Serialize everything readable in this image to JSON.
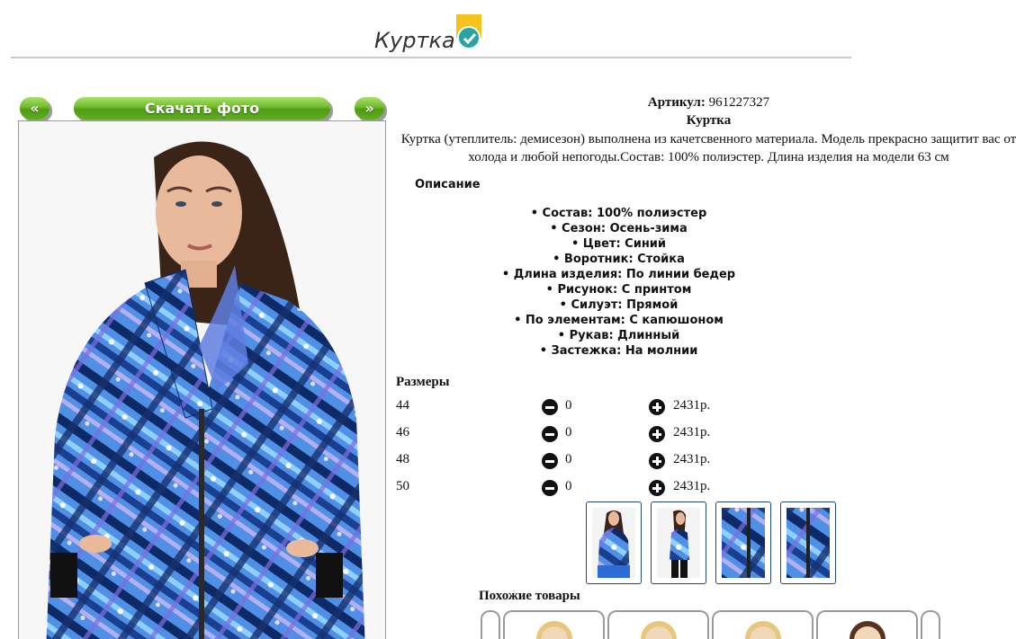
{
  "header": {
    "title": "Куртка"
  },
  "gallery": {
    "prev_label": "«",
    "download_label": "Скачать фото",
    "next_label": "»"
  },
  "product": {
    "article_label": "Артикул:",
    "article_value": "961227327",
    "name": "Куртка",
    "description": "Куртка (утеплитель: демисезон) выполнена из качетсвенного материала. Модель прекрасно защитит вас от холода и любой непогоды.Состав: 100% полиэстер. Длина изделия на модели 63 см",
    "description_title": "Описание",
    "attributes": [
      "• Состав: 100% полиэстер",
      "• Сезон: Осень-зима",
      "• Цвет: Синий",
      "• Воротник: Стойка",
      "• Длина изделия: По линии бедер",
      "• Рисунок: С принтом",
      "• Силуэт: Прямой",
      "• По элементам: С капюшоном",
      "• Рукав: Длинный",
      "• Застежка: На молнии"
    ]
  },
  "sizes": {
    "title": "Размеры",
    "rows": [
      {
        "size": "44",
        "qty": "0",
        "price": "2431р."
      },
      {
        "size": "46",
        "qty": "0",
        "price": "2431р."
      },
      {
        "size": "48",
        "qty": "0",
        "price": "2431р."
      },
      {
        "size": "50",
        "qty": "0",
        "price": "2431р."
      }
    ]
  },
  "similar": {
    "title": "Похожие товары"
  },
  "colors": {
    "button_green": "#5fae1f",
    "badge_yellow": "#f6c21c",
    "badge_teal": "#2aa3a3",
    "jacket_blue": "#2f6bd6"
  }
}
